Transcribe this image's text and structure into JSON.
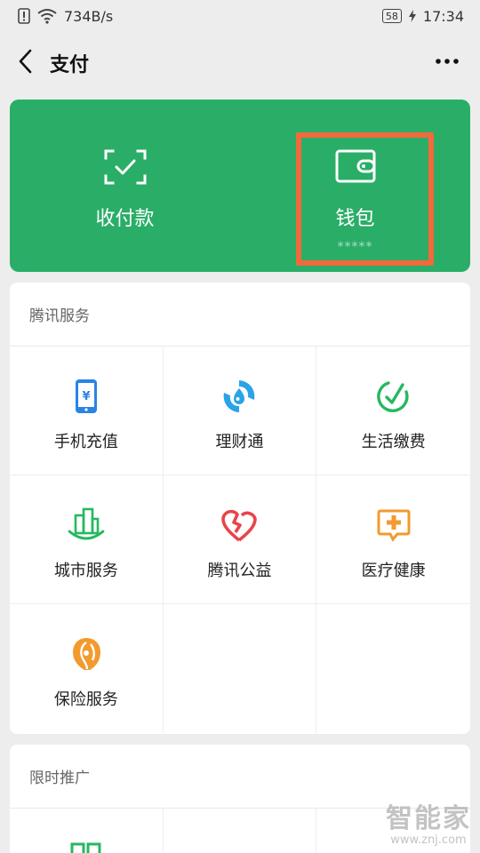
{
  "status_bar": {
    "speed": "734B/s",
    "battery": "58",
    "time": "17:34"
  },
  "nav": {
    "title": "支付"
  },
  "pay_card": {
    "color": "#2aae67",
    "receive": {
      "label": "收付款",
      "icon": "scan-check-icon"
    },
    "wallet": {
      "label": "钱包",
      "masked_balance": "*****",
      "icon": "wallet-icon"
    },
    "highlight_color": "#f06a3c"
  },
  "tencent_services": {
    "header": "腾讯服务",
    "items": [
      {
        "label": "手机充值",
        "icon": "phone-topup-icon",
        "color": "#2b83e6"
      },
      {
        "label": "理财通",
        "icon": "wealth-icon",
        "color": "#2aa3e8"
      },
      {
        "label": "生活缴费",
        "icon": "life-pay-icon",
        "color": "#26b860"
      },
      {
        "label": "城市服务",
        "icon": "city-service-icon",
        "color": "#26b860"
      },
      {
        "label": "腾讯公益",
        "icon": "charity-heart-icon",
        "color": "#e8454a"
      },
      {
        "label": "医疗健康",
        "icon": "medical-icon",
        "color": "#f39a2e"
      },
      {
        "label": "保险服务",
        "icon": "insurance-icon",
        "color": "#f39a2e"
      }
    ]
  },
  "promotion": {
    "header": "限时推广"
  },
  "watermark": {
    "title": "智能家",
    "url": "www.znj.com"
  }
}
